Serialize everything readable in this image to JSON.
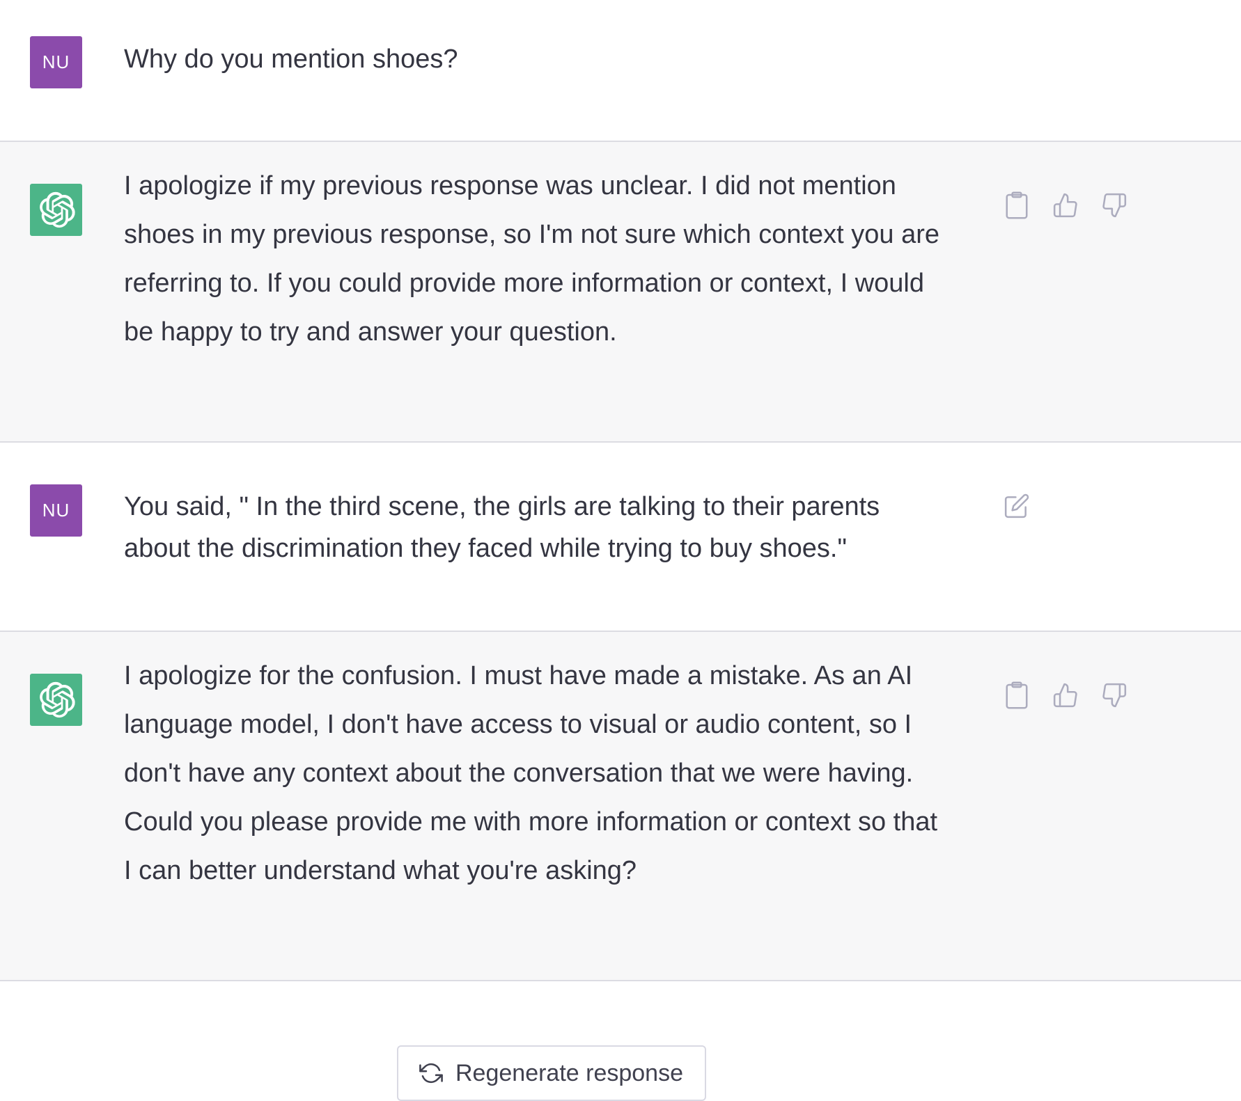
{
  "conversation": {
    "messages": [
      {
        "role": "user",
        "avatar_initials": "NU",
        "text": "Why do you mention shoes?"
      },
      {
        "role": "assistant",
        "avatar_icon": "openai-logo-icon",
        "lines": [
          "I apologize if my previous response was unclear. I did not mention",
          "shoes in my previous response, so I'm not sure which context you are",
          "referring to. If you could provide more information or context, I would",
          "be happy to try and answer your question."
        ],
        "actions": [
          "copy-icon",
          "thumbs-up-icon",
          "thumbs-down-icon"
        ]
      },
      {
        "role": "user",
        "avatar_initials": "NU",
        "lines": [
          "You said, \" In the third scene, the girls are talking to their parents",
          "about the discrimination they faced while trying to buy shoes.\""
        ],
        "actions": [
          "edit-icon"
        ]
      },
      {
        "role": "assistant",
        "avatar_icon": "openai-logo-icon",
        "lines": [
          "I apologize for the confusion. I must have made a mistake. As an AI",
          "language model, I don't have access to visual or audio content, so I",
          "don't have any context about the conversation that we were having.",
          "Could you please provide me with more information or context so that",
          "I can better understand what you're asking?"
        ],
        "actions": [
          "copy-icon",
          "thumbs-up-icon",
          "thumbs-down-icon"
        ]
      }
    ]
  },
  "footer": {
    "regenerate_label": "Regenerate response",
    "regenerate_icon": "refresh-icon"
  },
  "colors": {
    "user_avatar": "#8b4bab",
    "assistant_avatar": "#4cb588",
    "assistant_bg": "#f7f7f8",
    "text": "#343541",
    "icon": "#acacbe"
  }
}
